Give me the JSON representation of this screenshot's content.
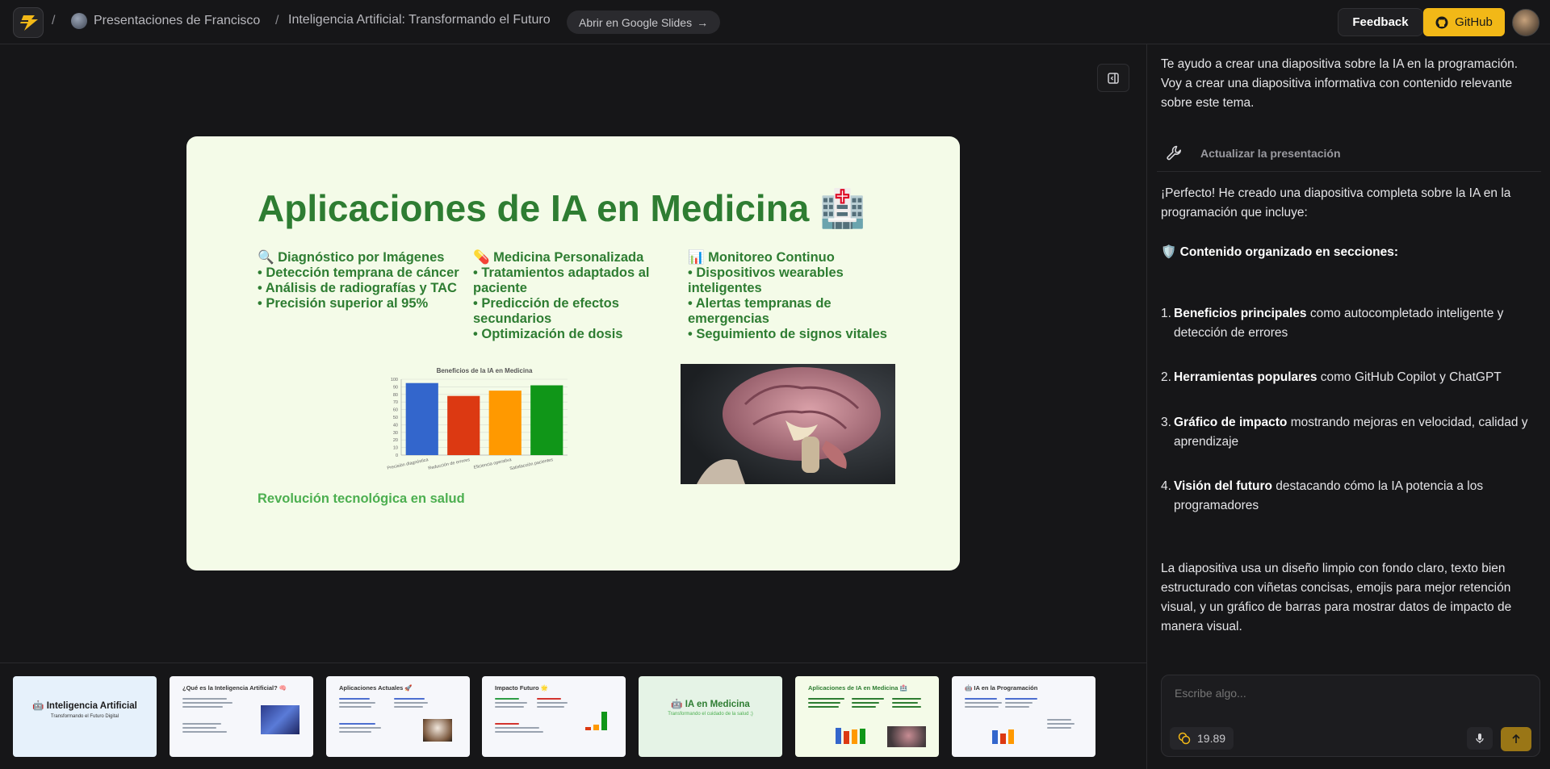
{
  "header": {
    "owner_name": "Presentaciones de Francisco",
    "presentation_title": "Inteligencia Artificial: Transformando el Futuro",
    "open_slides_label": "Abrir en Google Slides",
    "feedback_label": "Feedback",
    "github_label": "GitHub",
    "separator": "/"
  },
  "slide": {
    "title": "Aplicaciones de IA en Medicina 🏥",
    "columns": [
      {
        "heading": "🔍 Diagnóstico por Imágenes",
        "items": [
          "• Detección temprana de cáncer",
          "• Análisis de radiografías y TAC",
          "• Precisión superior al 95%"
        ]
      },
      {
        "heading": "💊 Medicina Personalizada",
        "items": [
          "• Tratamientos adaptados al",
          "paciente",
          "• Predicción de efectos",
          "secundarios",
          "• Optimización de dosis"
        ]
      },
      {
        "heading": "📊 Monitoreo Continuo",
        "items": [
          "• Dispositivos wearables",
          "inteligentes",
          "• Alertas tempranas de",
          "emergencias",
          "• Seguimiento de signos vitales"
        ]
      }
    ],
    "footer": "Revolución tecnológica en salud"
  },
  "chart_data": {
    "type": "bar",
    "title": "Beneficios de la IA en Medicina",
    "categories": [
      "Precisión diagnóstica",
      "Reducción de errores",
      "Eficiencia operativa",
      "Satisfacción pacientes"
    ],
    "values": [
      95,
      78,
      85,
      92
    ],
    "colors": [
      "#3366cc",
      "#dc3912",
      "#ff9900",
      "#109618"
    ],
    "ylim": [
      0,
      100
    ],
    "yticks": [
      0,
      10,
      20,
      30,
      40,
      50,
      60,
      70,
      80,
      90,
      100
    ],
    "grid": true
  },
  "thumbnails": [
    {
      "title": "🤖 Inteligencia Artificial",
      "subtitle": "Transformando el Futuro Digital",
      "bg": "#e6f1fb"
    },
    {
      "title": "¿Qué es la Inteligencia Artificial? 🧠",
      "bg": "#f6f7fb"
    },
    {
      "title": "Aplicaciones Actuales 🚀",
      "bg": "#f6f7fb"
    },
    {
      "title": "Impacto Futuro 🌟",
      "bg": "#f6f7fb"
    },
    {
      "title": "🤖 IA en Medicina",
      "subtitle": "Transformando el cuidado de la salud ;)",
      "bg": "#e5f3e6"
    },
    {
      "title": "Aplicaciones de IA en Medicina 🏥",
      "bg": "#f4fbe8"
    },
    {
      "title": "🤖 IA en la Programación",
      "bg": "#f6f7fb"
    }
  ],
  "chat": {
    "msg1": "Te ayudo a crear una diapositiva sobre la IA en la programación. Voy a crear una diapositiva informativa con contenido relevante sobre este tema.",
    "tool_label": "Actualizar la presentación",
    "msg2": "¡Perfecto! He creado una diapositiva completa sobre la IA en la programación que incluye:",
    "sections_heading": "Contenido organizado en secciones:",
    "list": [
      {
        "num": "1.",
        "bold": "Beneficios principales",
        "rest": " como autocompletado inteligente y detección de errores"
      },
      {
        "num": "2.",
        "bold": "Herramientas populares",
        "rest": " como GitHub Copilot y ChatGPT"
      },
      {
        "num": "3.",
        "bold": "Gráfico de impacto",
        "rest": " mostrando mejoras en velocidad, calidad y aprendizaje"
      },
      {
        "num": "4.",
        "bold": "Visión del futuro",
        "rest": " destacando cómo la IA potencia a los programadores"
      }
    ],
    "msg3": "La diapositiva usa un diseño limpio con fondo claro, texto bien estructurado con viñetas concisas, emojis para mejor retención visual, y un gráfico de barras para mostrar datos de impacto de manera visual.",
    "composer_placeholder": "Escribe algo...",
    "credits": "19.89"
  }
}
